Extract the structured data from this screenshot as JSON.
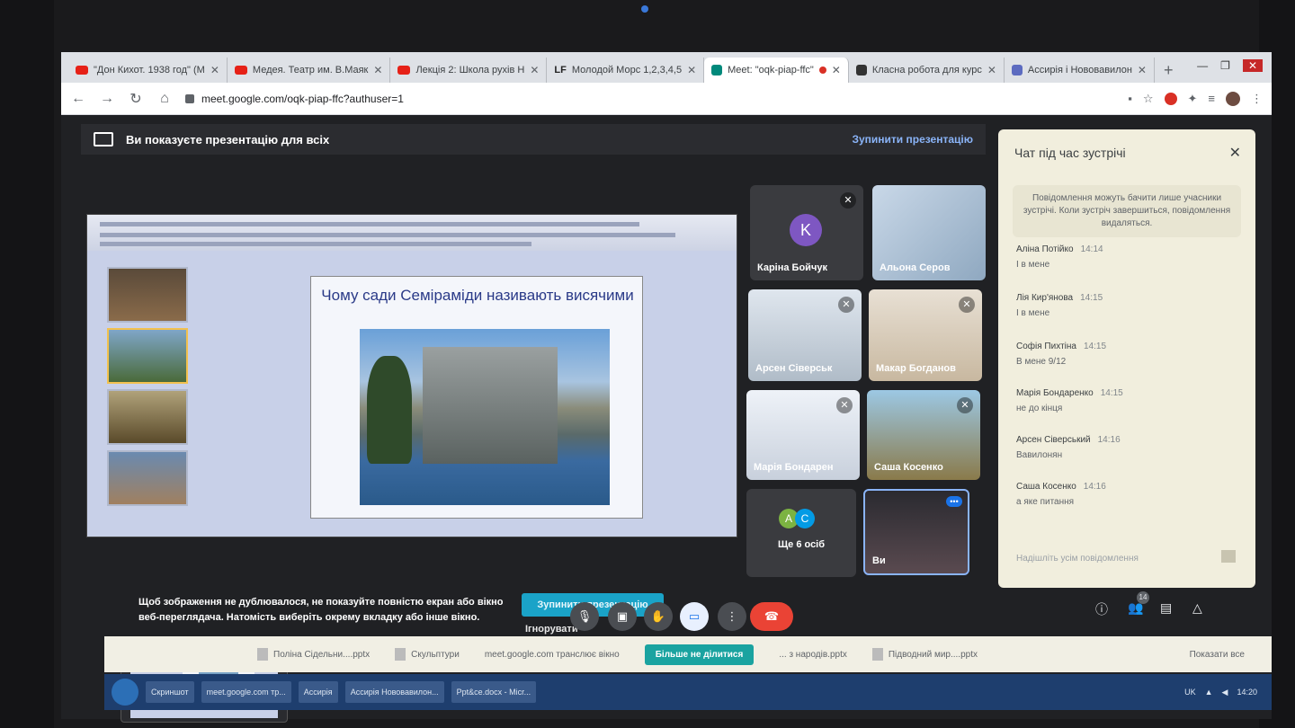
{
  "tabs": [
    {
      "title": "\"Дон Кихот. 1938 год\" (М",
      "icon": "youtube-icon",
      "active": false
    },
    {
      "title": "Медея. Театр им. В.Маяк",
      "icon": "youtube-icon",
      "active": false
    },
    {
      "title": "Лекція 2: Школа рухів Н",
      "icon": "youtube-icon",
      "active": false
    },
    {
      "title": "Молодой Морс 1,2,3,4,5",
      "icon": "lf-icon",
      "active": false
    },
    {
      "title": "Meet: \"oqk-piap-ffc\"",
      "icon": "meet-icon",
      "active": true
    },
    {
      "title": "Класна робота для курс",
      "icon": "classroom-icon",
      "active": false
    },
    {
      "title": "Ассирія і Нововавилон",
      "icon": "doc-icon",
      "active": false
    }
  ],
  "lf_favicon_text": "LF",
  "address": {
    "url": "meet.google.com/oqk-piap-ffc?authuser=1"
  },
  "presenting": {
    "banner": "Ви показуєте презентацію для всіх",
    "stop_label": "Зупинити презентацію",
    "hint": "Щоб зображення не дублювалося, не показуйте повністю екран або вікно веб-переглядача. Натомість виберіть окрему вкладку або інше вікно.",
    "stop_button": "Зупинити презентацію",
    "ignore": "Ігнорувати"
  },
  "slide": {
    "title": "Чому сади Семіраміди називають висячими"
  },
  "participants": [
    {
      "name": "Каріна Бойчук",
      "initial": "K",
      "muted": true
    },
    {
      "name": "Альона Серов",
      "muted": false
    },
    {
      "name": "Арсен Сіверськ",
      "muted": true
    },
    {
      "name": "Макар Богданов",
      "muted": true
    },
    {
      "name": "Марія Бондарен",
      "muted": true
    },
    {
      "name": "Саша Косенко",
      "muted": true
    }
  ],
  "others": {
    "label": "Ще 6 осіб",
    "avatars": [
      "A",
      "C"
    ]
  },
  "self_tile": {
    "name": "Ви"
  },
  "chat": {
    "title": "Чат під час зустрічі",
    "note": "Повідомлення можуть бачити лише учасники зустрічі. Коли зустріч завершиться, повідомлення видаляться.",
    "messages": [
      {
        "sender": "Аліна Потійко",
        "time": "14:14",
        "text": "І в мене"
      },
      {
        "sender": "Лія Кир'янова",
        "time": "14:15",
        "text": "І в мене"
      },
      {
        "sender": "Софія Пихтіна",
        "time": "14:15",
        "text": "В мене 9/12"
      },
      {
        "sender": "Марія Бондаренко",
        "time": "14:15",
        "text": "не до кінця"
      },
      {
        "sender": "Арсен Сіверський",
        "time": "14:16",
        "text": "Вавилонян"
      },
      {
        "sender": "Саша Косенко",
        "time": "14:16",
        "text": "а яке питання"
      }
    ],
    "input_placeholder": "Надішліть усім повідомлення"
  },
  "controls": [
    "mic-icon",
    "camera-icon",
    "raise-hand-icon",
    "present-icon",
    "more-icon",
    "end-call-icon"
  ],
  "side_icons": [
    "info-icon",
    "people-icon",
    "chat-icon",
    "activities-icon"
  ],
  "people_count": "14",
  "downloads": {
    "items": [
      "Поліна Сідельни....pptx",
      "Скульптури",
      "meet.google.com транслює вікно"
    ],
    "share_button": "Більше не ділитися",
    "more_items": [
      "... з народів.pptx",
      "Підводний мир....pptx"
    ],
    "show_all": "Показати все"
  },
  "taskbar": {
    "items": [
      "Скриншот",
      "meet.google.com тр...",
      "Ассирія",
      "Ассирія Нововавилон...",
      "Ppt&ce.docx - Micr..."
    ],
    "tray_lang": "UK",
    "clock": "14:20"
  },
  "colors": {
    "chat_bg": "#f1eedd",
    "accent": "#8ab4f8",
    "end_call": "#ea4335"
  }
}
